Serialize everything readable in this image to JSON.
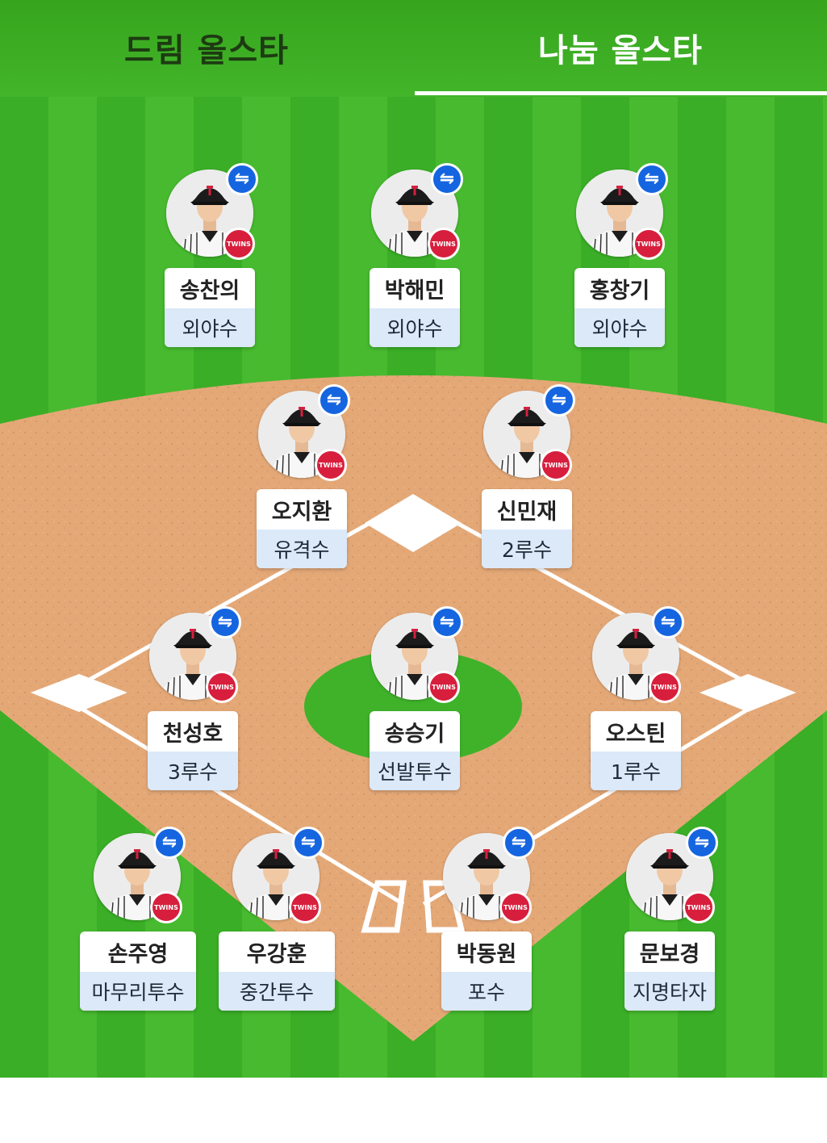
{
  "tabs": [
    {
      "label": "드림 올스타",
      "active": false
    },
    {
      "label": "나눔 올스타",
      "active": true
    }
  ],
  "colors": {
    "grass": "#3dad26",
    "dirt": "#e3a874",
    "lines": "#ffffff",
    "swap_button": "#1565e0",
    "team_logo": "#d71f3d",
    "position_band": "#dbe9f8"
  },
  "swap_icon": "⇋",
  "team_badge": "TWINS",
  "players": [
    {
      "name": "송찬의",
      "position": "외야수"
    },
    {
      "name": "박해민",
      "position": "외야수"
    },
    {
      "name": "홍창기",
      "position": "외야수"
    },
    {
      "name": "오지환",
      "position": "유격수"
    },
    {
      "name": "신민재",
      "position": "2루수"
    },
    {
      "name": "천성호",
      "position": "3루수"
    },
    {
      "name": "송승기",
      "position": "선발투수"
    },
    {
      "name": "오스틴",
      "position": "1루수"
    },
    {
      "name": "손주영",
      "position": "마무리투수"
    },
    {
      "name": "우강훈",
      "position": "중간투수"
    },
    {
      "name": "박동원",
      "position": "포수"
    },
    {
      "name": "문보경",
      "position": "지명타자"
    }
  ]
}
